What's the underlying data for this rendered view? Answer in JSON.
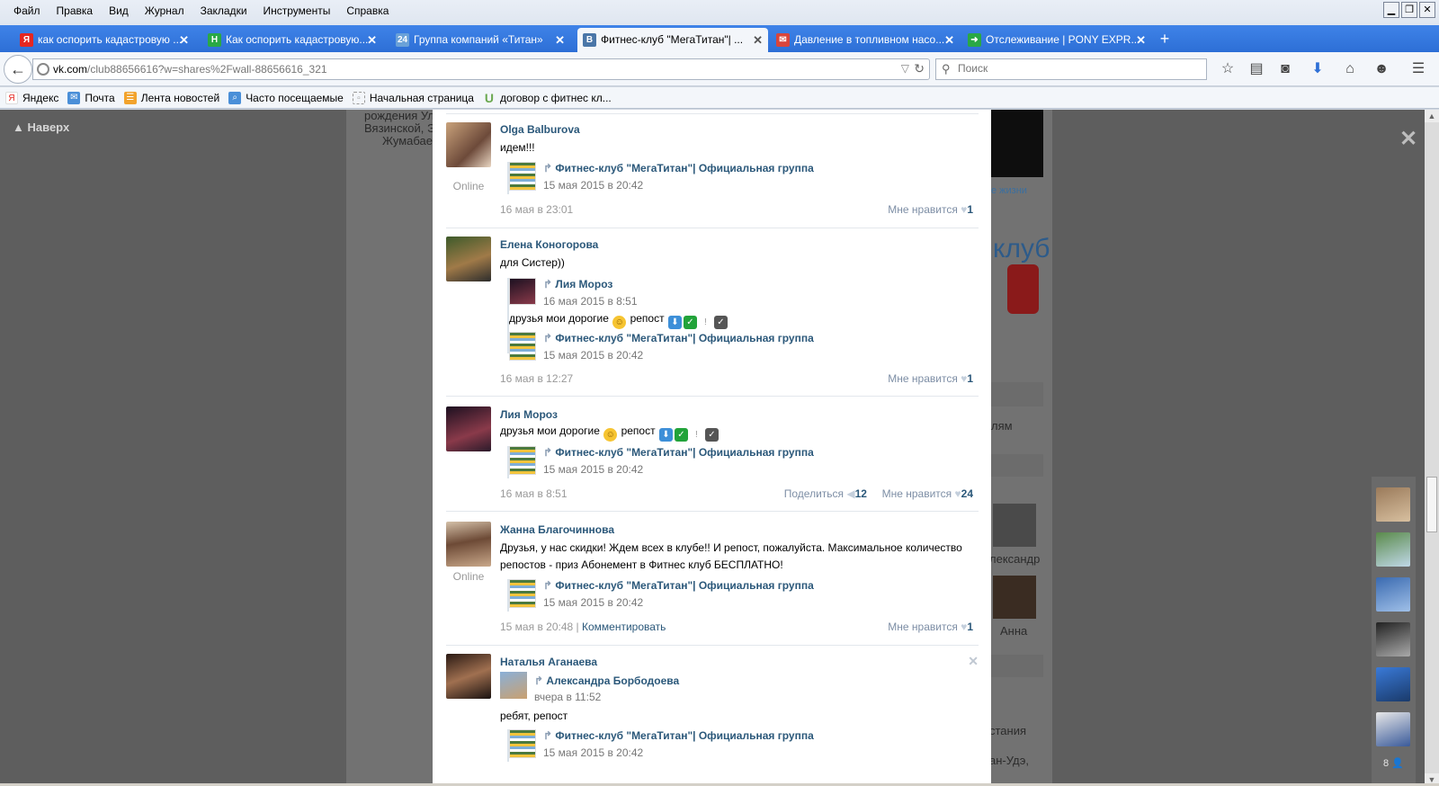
{
  "menu": [
    "Файл",
    "Правка",
    "Вид",
    "Журнал",
    "Закладки",
    "Инструменты",
    "Справка"
  ],
  "tabs": [
    {
      "label": "как оспорить кадастровую ...",
      "fav": "Я",
      "color": "#e52620"
    },
    {
      "label": "Как оспорить кадастровую...",
      "fav": "H",
      "color": "#2aa845"
    },
    {
      "label": "Группа компаний «Титан»",
      "fav": "24",
      "color": "#6aa1d8"
    },
    {
      "label": "Фитнес-клуб \"МегаТитан\"| ...",
      "fav": "В",
      "color": "#4a76a8"
    },
    {
      "label": "Давление в топливном насо...",
      "fav": "✉",
      "color": "#d9453b"
    },
    {
      "label": "Отслеживание | PONY EXPR...",
      "fav": "➜",
      "color": "#2aa845"
    }
  ],
  "url": {
    "host": "vk.com",
    "path": "/club88656616?w=shares%2Fwall-88656616_321"
  },
  "search_placeholder": "Поиск",
  "bookmarks": [
    {
      "label": "Яндекс",
      "icon": "Я",
      "color": "#e52620"
    },
    {
      "label": "Почта",
      "icon": "✉",
      "color": "#4a8fd8"
    },
    {
      "label": "Лента новостей",
      "icon": "☰",
      "color": "#f2a32c"
    },
    {
      "label": "Часто посещаемые",
      "icon": "⌕",
      "color": "#4a8fd8"
    },
    {
      "label": "Начальная страница",
      "icon": "▫",
      "color": "#999"
    },
    {
      "label": "договор с фитнес кл...",
      "icon": "U",
      "color": "#6aa84f"
    }
  ],
  "overlay": {
    "up_label": "Наверх",
    "close": "✕"
  },
  "bg_text": {
    "left": [
      "рождения Ул",
      "Вязинской, Э",
      "Жумабаев"
    ],
    "right": [
      "е жизни",
      "клуб",
      "лям",
      "лександр",
      "Анна",
      "стания",
      "ан-Удэ,"
    ]
  },
  "repost_group": "Фитнес-клуб \"МегаТитан\"| Официальная группа",
  "repost_date": "15 мая 2015 в 20:42",
  "posts": [
    {
      "author": "Olga Balburova",
      "online": "Online",
      "text": "идем!!!",
      "meta": "16 мая в 23:01",
      "likes_label": "Мне нравится",
      "likes": "1"
    },
    {
      "author": "Елена Коногорова",
      "text": "для Систер))",
      "inner_author": "Лия Мороз",
      "inner_date": "16 мая 2015 в 8:51",
      "inner_text": "друзья мои дорогие",
      "inner_text2": "репост",
      "meta": "16 мая в 12:27",
      "likes_label": "Мне нравится",
      "likes": "1"
    },
    {
      "author": "Лия Мороз",
      "text": "друзья мои дорогие",
      "text2": "репост",
      "meta": "16 мая в 8:51",
      "share_label": "Поделиться",
      "shares": "12",
      "likes_label": "Мне нравится",
      "likes": "24"
    },
    {
      "author": "Жанна Благочиннова",
      "online": "Online",
      "text": "Друзья, у нас скидки! Ждем всех в клубе!! И репост, пожалуйста. Максимальное количество репостов - приз Абонемент в Фитнес клуб БЕСПЛАТНО!",
      "meta": "15 мая в 20:48",
      "comment_label": "Комментировать",
      "likes_label": "Мне нравится",
      "likes": "1"
    },
    {
      "author": "Наталья Аганаева",
      "inner_author": "Александра Борбодоева",
      "inner_date": "вчера в 11:52",
      "text": "ребят, репост"
    }
  ],
  "right_count": "8"
}
